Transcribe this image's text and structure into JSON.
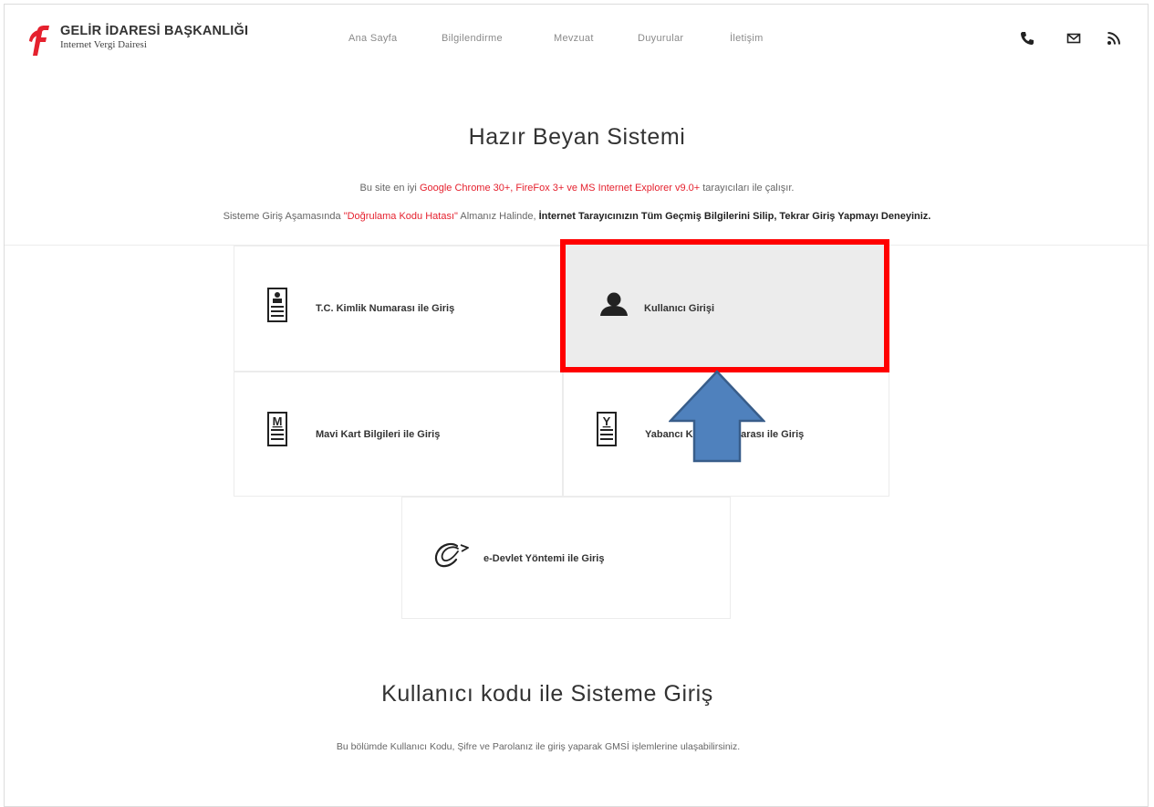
{
  "header": {
    "brand_title": "GELİR İDARESİ BAŞKANLIĞI",
    "brand_subtitle": "Internet Vergi Dairesi",
    "nav": [
      "Ana Sayfa",
      "Bilgilendirme",
      "Mevzuat",
      "Duyurular",
      "İletişim"
    ],
    "icons": [
      "phone-icon",
      "mail-icon",
      "rss-icon"
    ]
  },
  "hero": {
    "title": "Hazır Beyan Sistemi",
    "line1": {
      "prefix": "Bu site en iyi ",
      "browsers": "Google Chrome 30+, FireFox 3+ ve MS Internet Explorer v9.0+",
      "suffix": " tarayıcıları ile çalışır."
    },
    "line2": {
      "prefix": "Sisteme Giriş Aşamasında ",
      "error": "\"Doğrulama Kodu Hatası\"",
      "middle": " Almanız Halinde, ",
      "advice": "İnternet Tarayıcınızın Tüm Geçmiş Bilgilerini Silip, Tekrar Giriş Yapmayı Deneyiniz."
    }
  },
  "login_options": {
    "tc": {
      "label": "T.C. Kimlik Numarası ile Giriş"
    },
    "user": {
      "label": "Kullanıcı Girişi",
      "selected": true
    },
    "mavi": {
      "label": "Mavi Kart Bilgileri ile Giriş",
      "icon_letter": "M"
    },
    "yabanci": {
      "label": "Yabancı Kimlik Numarası ile Giriş",
      "icon_letter": "Y"
    },
    "edevlet": {
      "label": "e-Devlet Yöntemi ile Giriş"
    }
  },
  "section": {
    "title": "Kullanıcı kodu ile Sisteme Giriş",
    "description": "Bu bölümde Kullanıcı Kodu, Şifre ve Parolanız ile giriş yaparak GMSİ işlemlerine ulaşabilirsiniz."
  },
  "colors": {
    "accent_red": "#e5212e",
    "highlight_border": "#ff0000",
    "arrow_fill": "#4f81bd",
    "arrow_stroke": "#385d8a"
  }
}
